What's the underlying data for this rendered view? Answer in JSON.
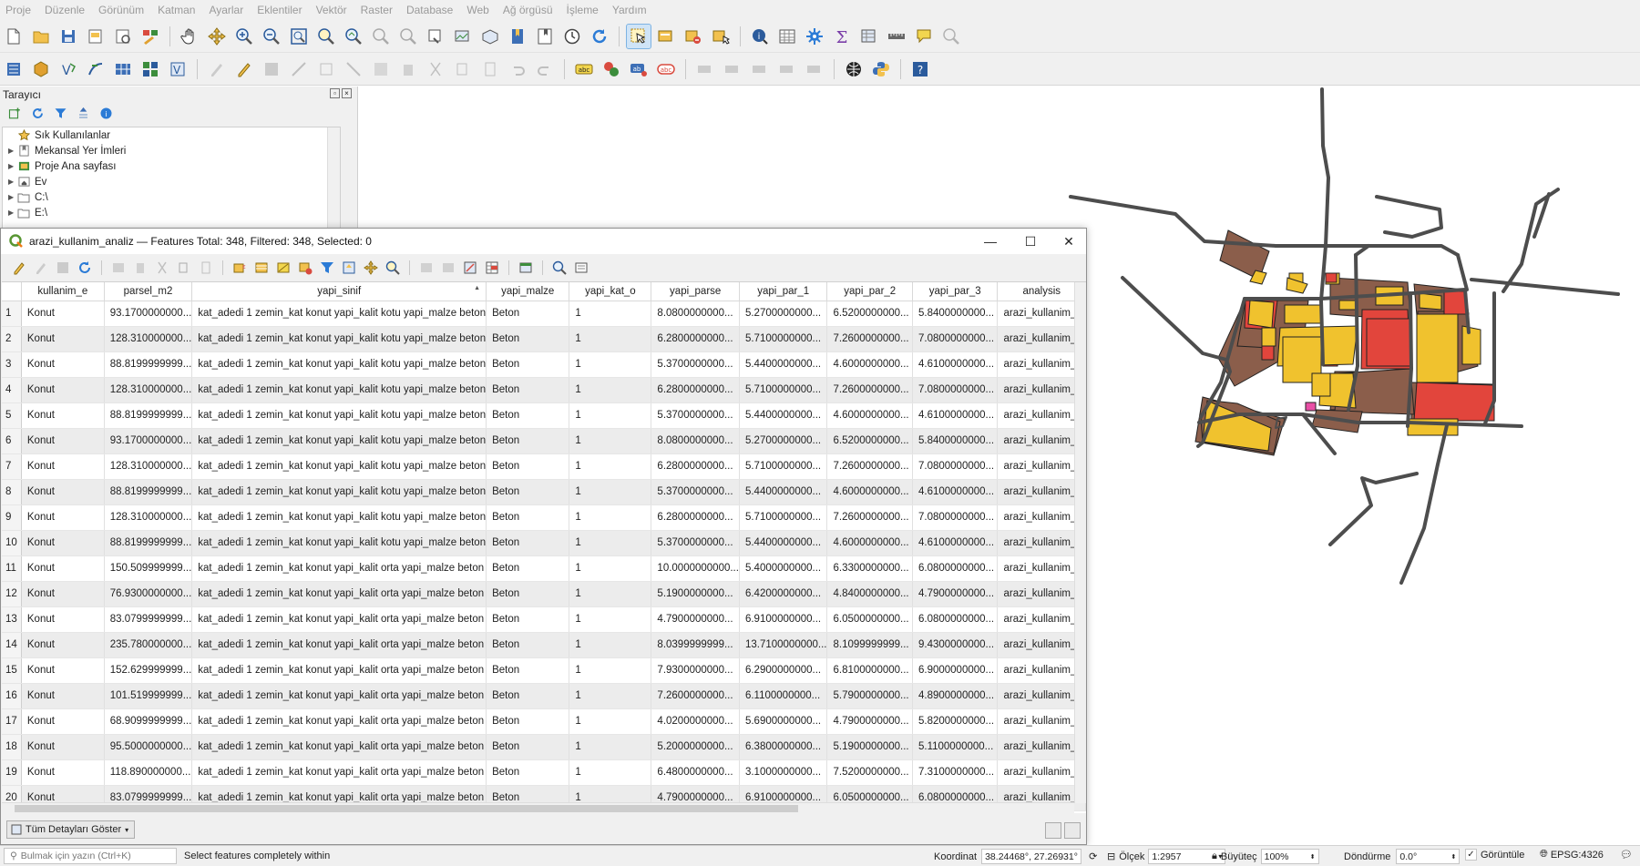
{
  "menu": [
    "Proje",
    "Düzenle",
    "Görünüm",
    "Katman",
    "Ayarlar",
    "Eklentiler",
    "Vektör",
    "Raster",
    "Database",
    "Web",
    "Ağ örgüsü",
    "İşleme",
    "Yardım"
  ],
  "browser": {
    "title": "Tarayıcı",
    "items": [
      {
        "label": "Sık Kullanılanlar",
        "icon": "star-icon",
        "expand": false
      },
      {
        "label": "Mekansal Yer İmleri",
        "icon": "bookmark-icon",
        "expand": true
      },
      {
        "label": "Proje Ana sayfası",
        "icon": "project-home-icon",
        "expand": true
      },
      {
        "label": "Ev",
        "icon": "home-folder-icon",
        "expand": true
      },
      {
        "label": "C:\\",
        "icon": "drive-icon",
        "expand": true
      },
      {
        "label": "E:\\",
        "icon": "drive-icon",
        "expand": true
      }
    ]
  },
  "attribute_table": {
    "title": "arazi_kullanim_analiz — Features Total: 348, Filtered: 348, Selected: 0",
    "columns": [
      "kullanim_e",
      "parsel_m2",
      "yapi_sinif",
      "yapi_malze",
      "yapi_kat_o",
      "yapi_parse",
      "yapi_par_1",
      "yapi_par_2",
      "yapi_par_3",
      "analysis"
    ],
    "rows": [
      [
        "1",
        "Konut",
        "93.1700000000...",
        "kat_adedi 1 zemin_kat konut yapi_kalit kotu yapi_malze beton",
        "Beton",
        "1",
        "8.0800000000...",
        "5.2700000000...",
        "6.5200000000...",
        "5.8400000000...",
        "arazi_kullanim_..."
      ],
      [
        "2",
        "Konut",
        "128.310000000...",
        "kat_adedi 1 zemin_kat konut yapi_kalit kotu yapi_malze beton",
        "Beton",
        "1",
        "6.2800000000...",
        "5.7100000000...",
        "7.2600000000...",
        "7.0800000000...",
        "arazi_kullanim_..."
      ],
      [
        "3",
        "Konut",
        "88.8199999999...",
        "kat_adedi 1 zemin_kat konut yapi_kalit kotu yapi_malze beton",
        "Beton",
        "1",
        "5.3700000000...",
        "5.4400000000...",
        "4.6000000000...",
        "4.6100000000...",
        "arazi_kullanim_..."
      ],
      [
        "4",
        "Konut",
        "128.310000000...",
        "kat_adedi 1 zemin_kat konut yapi_kalit kotu yapi_malze beton",
        "Beton",
        "1",
        "6.2800000000...",
        "5.7100000000...",
        "7.2600000000...",
        "7.0800000000...",
        "arazi_kullanim_..."
      ],
      [
        "5",
        "Konut",
        "88.8199999999...",
        "kat_adedi 1 zemin_kat konut yapi_kalit kotu yapi_malze beton",
        "Beton",
        "1",
        "5.3700000000...",
        "5.4400000000...",
        "4.6000000000...",
        "4.6100000000...",
        "arazi_kullanim_..."
      ],
      [
        "6",
        "Konut",
        "93.1700000000...",
        "kat_adedi 1 zemin_kat konut yapi_kalit kotu yapi_malze beton",
        "Beton",
        "1",
        "8.0800000000...",
        "5.2700000000...",
        "6.5200000000...",
        "5.8400000000...",
        "arazi_kullanim_..."
      ],
      [
        "7",
        "Konut",
        "128.310000000...",
        "kat_adedi 1 zemin_kat konut yapi_kalit kotu yapi_malze beton",
        "Beton",
        "1",
        "6.2800000000...",
        "5.7100000000...",
        "7.2600000000...",
        "7.0800000000...",
        "arazi_kullanim_..."
      ],
      [
        "8",
        "Konut",
        "88.8199999999...",
        "kat_adedi 1 zemin_kat konut yapi_kalit kotu yapi_malze beton",
        "Beton",
        "1",
        "5.3700000000...",
        "5.4400000000...",
        "4.6000000000...",
        "4.6100000000...",
        "arazi_kullanim_..."
      ],
      [
        "9",
        "Konut",
        "128.310000000...",
        "kat_adedi 1 zemin_kat konut yapi_kalit kotu yapi_malze beton",
        "Beton",
        "1",
        "6.2800000000...",
        "5.7100000000...",
        "7.2600000000...",
        "7.0800000000...",
        "arazi_kullanim_..."
      ],
      [
        "10",
        "Konut",
        "88.8199999999...",
        "kat_adedi 1 zemin_kat konut yapi_kalit kotu yapi_malze beton",
        "Beton",
        "1",
        "5.3700000000...",
        "5.4400000000...",
        "4.6000000000...",
        "4.6100000000...",
        "arazi_kullanim_..."
      ],
      [
        "11",
        "Konut",
        "150.509999999...",
        "kat_adedi 1 zemin_kat konut yapi_kalit orta yapi_malze beton",
        "Beton",
        "1",
        "10.0000000000...",
        "5.4000000000...",
        "6.3300000000...",
        "6.0800000000...",
        "arazi_kullanim_..."
      ],
      [
        "12",
        "Konut",
        "76.9300000000...",
        "kat_adedi 1 zemin_kat konut yapi_kalit orta yapi_malze beton",
        "Beton",
        "1",
        "5.1900000000...",
        "6.4200000000...",
        "4.8400000000...",
        "4.7900000000...",
        "arazi_kullanim_..."
      ],
      [
        "13",
        "Konut",
        "83.0799999999...",
        "kat_adedi 1 zemin_kat konut yapi_kalit orta yapi_malze beton",
        "Beton",
        "1",
        "4.7900000000...",
        "6.9100000000...",
        "6.0500000000...",
        "6.0800000000...",
        "arazi_kullanim_..."
      ],
      [
        "14",
        "Konut",
        "235.780000000...",
        "kat_adedi 1 zemin_kat konut yapi_kalit orta yapi_malze beton",
        "Beton",
        "1",
        "8.0399999999...",
        "13.7100000000...",
        "8.1099999999...",
        "9.4300000000...",
        "arazi_kullanim_..."
      ],
      [
        "15",
        "Konut",
        "152.629999999...",
        "kat_adedi 1 zemin_kat konut yapi_kalit orta yapi_malze beton",
        "Beton",
        "1",
        "7.9300000000...",
        "6.2900000000...",
        "6.8100000000...",
        "6.9000000000...",
        "arazi_kullanim_..."
      ],
      [
        "16",
        "Konut",
        "101.519999999...",
        "kat_adedi 1 zemin_kat konut yapi_kalit orta yapi_malze beton",
        "Beton",
        "1",
        "7.2600000000...",
        "6.1100000000...",
        "5.7900000000...",
        "4.8900000000...",
        "arazi_kullanim_..."
      ],
      [
        "17",
        "Konut",
        "68.9099999999...",
        "kat_adedi 1 zemin_kat konut yapi_kalit orta yapi_malze beton",
        "Beton",
        "1",
        "4.0200000000...",
        "5.6900000000...",
        "4.7900000000...",
        "5.8200000000...",
        "arazi_kullanim_..."
      ],
      [
        "18",
        "Konut",
        "95.5000000000...",
        "kat_adedi 1 zemin_kat konut yapi_kalit orta yapi_malze beton",
        "Beton",
        "1",
        "5.2000000000...",
        "6.3800000000...",
        "5.1900000000...",
        "5.1100000000...",
        "arazi_kullanim_..."
      ],
      [
        "19",
        "Konut",
        "118.890000000...",
        "kat_adedi 1 zemin_kat konut yapi_kalit orta yapi_malze beton",
        "Beton",
        "1",
        "6.4800000000...",
        "3.1000000000...",
        "7.5200000000...",
        "7.3100000000...",
        "arazi_kullanim_..."
      ],
      [
        "20",
        "Konut",
        "83.0799999999...",
        "kat_adedi 1 zemin_kat konut yapi_kalit orta yapi_malze beton",
        "Beton",
        "1",
        "4.7900000000...",
        "6.9100000000...",
        "6.0500000000...",
        "6.0800000000...",
        "arazi_kullanim_..."
      ]
    ],
    "show_all_label": "Tüm Detayları Göster"
  },
  "statusbar": {
    "locator_placeholder": "Bulmak için yazın (Ctrl+K)",
    "message": "Select features completely within",
    "coord_label": "Koordinat",
    "coord_value": "38.24468°, 27.26931°",
    "scale_label": "Ölçek",
    "scale_value": "1:2957",
    "magnifier_label": "Büyüteç",
    "magnifier_value": "100%",
    "rotation_label": "Döndürme",
    "rotation_value": "0.0°",
    "render_label": "Görüntüle",
    "crs": "EPSG:4326"
  },
  "map_colors": {
    "road": "#4d4d4d",
    "brown": "#8b5e4b",
    "red": "#e2453c",
    "yellow": "#f0c22e",
    "pink": "#e94fa6"
  }
}
